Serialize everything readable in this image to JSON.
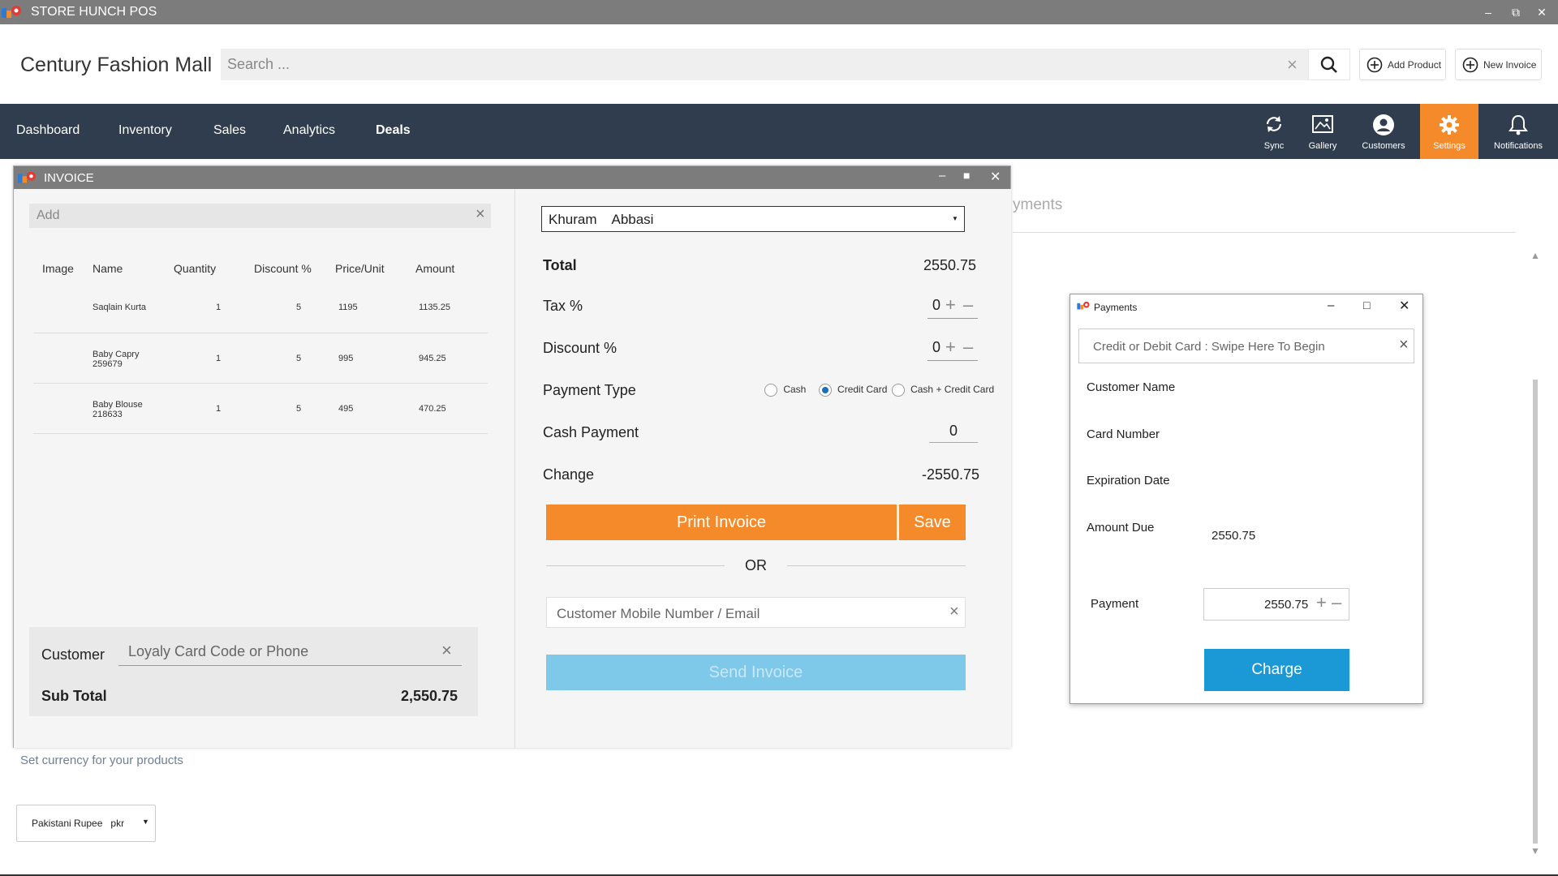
{
  "app": {
    "title": "STORE HUNCH POS"
  },
  "header": {
    "store_name": "Century Fashion Mall",
    "search_placeholder": "Search ...",
    "add_product_label": "Add Product",
    "new_invoice_label": "New Invoice"
  },
  "nav": {
    "items": [
      "Dashboard",
      "Inventory",
      "Sales",
      "Analytics",
      "Deals"
    ],
    "icons": [
      {
        "label": "Sync",
        "icon": "sync-icon"
      },
      {
        "label": "Gallery",
        "icon": "gallery-icon"
      },
      {
        "label": "Customers",
        "icon": "customers-icon"
      },
      {
        "label": "Settings",
        "icon": "settings-icon"
      },
      {
        "label": "Notifications",
        "icon": "bell-icon"
      }
    ],
    "active": "Settings",
    "active_color": "#f58a2b"
  },
  "background_page": {
    "tab_fragment": "yments",
    "currency_hint": "Set currency for your products",
    "currency_value": "Pakistani Rupee   pkr"
  },
  "invoice": {
    "title": "INVOICE",
    "add_placeholder": "Add",
    "columns": [
      "Image",
      "Name",
      "Quantity",
      "Discount %",
      "Price/Unit",
      "Amount"
    ],
    "rows": [
      {
        "name": "Saqlain Kurta",
        "name2": "",
        "quantity": "1",
        "discount": "5",
        "price": "1195",
        "amount": "1135.25"
      },
      {
        "name": "Baby Capry",
        "name2": "259679",
        "quantity": "1",
        "discount": "5",
        "price": "995",
        "amount": "945.25"
      },
      {
        "name": "Baby Blouse",
        "name2": "218633",
        "quantity": "1",
        "discount": "5",
        "price": "495",
        "amount": "470.25"
      }
    ],
    "customer_label": "Customer",
    "customer_placeholder": "Loyaly Card Code or Phone",
    "subtotal_label": "Sub Total",
    "subtotal_value": "2,550.75",
    "customer_select": "Khuram    Abbasi",
    "total_label": "Total",
    "total_value": "2550.75",
    "tax_label": "Tax %",
    "tax_value": "0",
    "discount_label": "Discount %",
    "discount_value": "0",
    "payment_type_label": "Payment Type",
    "payment_options": [
      "Cash",
      "Credit Card",
      "Cash + Credit Card"
    ],
    "payment_selected": "Credit Card",
    "cash_payment_label": "Cash Payment",
    "cash_payment_value": "0",
    "change_label": "Change",
    "change_value": "-2550.75",
    "print_label": "Print Invoice",
    "save_label": "Save",
    "or_label": "OR",
    "contact_placeholder": "Customer Mobile Number / Email",
    "send_label": "Send Invoice"
  },
  "payments": {
    "title": "Payments",
    "swipe_placeholder": "Credit or Debit Card : Swipe Here To Begin",
    "customer_name_label": "Customer Name",
    "card_number_label": "Card Number",
    "expiration_label": "Expiration Date",
    "amount_due_label": "Amount Due",
    "amount_due_value": "2550.75",
    "payment_label": "Payment",
    "payment_value": "2550.75",
    "charge_label": "Charge"
  }
}
